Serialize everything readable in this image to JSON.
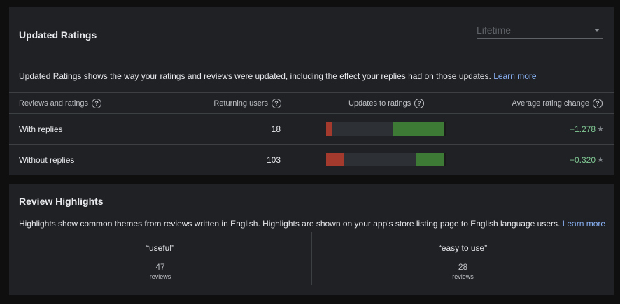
{
  "updated_ratings": {
    "title": "Updated Ratings",
    "period_select": {
      "value": "Lifetime",
      "icon": "dropdown-caret"
    },
    "description": "Updated Ratings shows the way your ratings and reviews were updated, including the effect your replies had on those updates.",
    "learn_more": "Learn more",
    "columns": {
      "reviews_and_ratings": "Reviews and ratings",
      "returning_users": "Returning users",
      "updates_to_ratings": "Updates to ratings",
      "average_rating_change": "Average rating change"
    },
    "help_icon": "?",
    "rows": [
      {
        "label": "With replies",
        "returning_users": "18",
        "change": "+1.278",
        "distribution": {
          "negative": 0.05,
          "neutral": 0.5,
          "positive": 0.43
        }
      },
      {
        "label": "Without replies",
        "returning_users": "103",
        "change": "+0.320",
        "distribution": {
          "negative": 0.15,
          "neutral": 0.6,
          "positive": 0.23
        }
      }
    ],
    "star": "★",
    "colors": {
      "negative": "#a43a2e",
      "positive": "#3c7a36",
      "change": "#81c995",
      "link": "#8ab4f8"
    }
  },
  "review_highlights": {
    "title": "Review Highlights",
    "description": "Highlights show common themes from reviews written in English. Highlights are shown on your app's store listing page to English language users.",
    "learn_more": "Learn more",
    "items": [
      {
        "term": "“useful”",
        "count": "47",
        "unit": "reviews"
      },
      {
        "term": "“easy to use”",
        "count": "28",
        "unit": "reviews"
      }
    ]
  }
}
